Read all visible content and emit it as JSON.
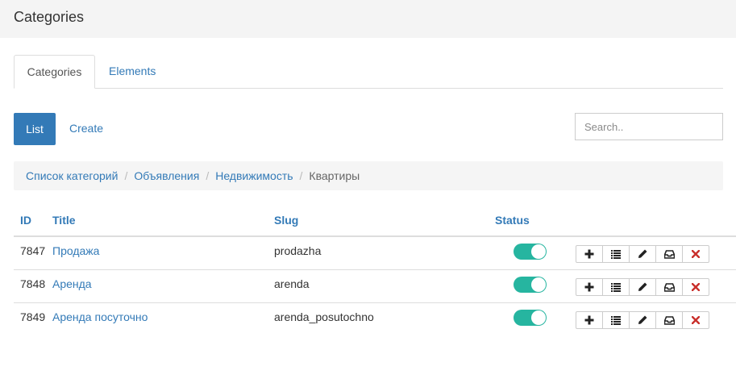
{
  "header": {
    "title": "Categories"
  },
  "tabs": [
    {
      "label": "Categories",
      "active": true
    },
    {
      "label": "Elements",
      "active": false
    }
  ],
  "toolbar": {
    "list_label": "List",
    "create_label": "Create"
  },
  "search": {
    "placeholder": "Search.."
  },
  "breadcrumb": [
    "Список категорий",
    "Объявления",
    "Недвижимость",
    "Квартиры"
  ],
  "breadcrumb_separator": "/",
  "table": {
    "columns": [
      "ID",
      "Title",
      "Slug",
      "Status"
    ],
    "rows": [
      {
        "id": "7847",
        "title": "Продажа",
        "slug": "prodazha",
        "status": true
      },
      {
        "id": "7848",
        "title": "Аренда",
        "slug": "arenda",
        "status": true
      },
      {
        "id": "7849",
        "title": "Аренда посуточно",
        "slug": "arenda_posutochno",
        "status": true
      }
    ],
    "row_actions": [
      "plus-icon",
      "list-icon",
      "pencil-icon",
      "inbox-icon",
      "remove-icon"
    ]
  },
  "colors": {
    "accent": "#337ab7",
    "toggle_on": "#26b5a0",
    "danger": "#c9302c"
  }
}
